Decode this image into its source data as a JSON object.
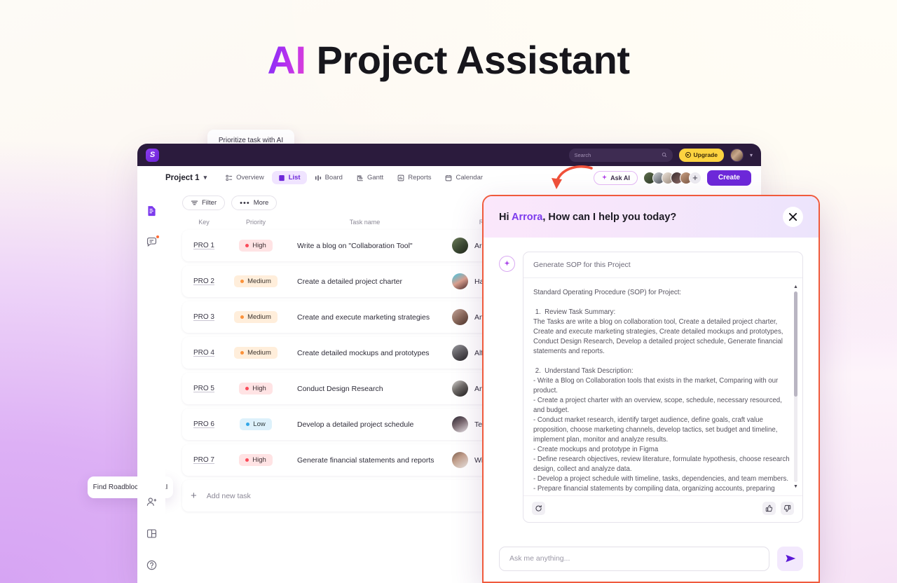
{
  "hero": {
    "ai": "AI",
    "rest": " Project Assistant"
  },
  "topbar": {
    "logo": "brand-logo",
    "search_placeholder": "Search",
    "upgrade_label": "Upgrade"
  },
  "toolbar": {
    "project_name": "Project 1",
    "tabs": [
      {
        "label": "Overview",
        "icon": "overview-icon",
        "active": false
      },
      {
        "label": "List",
        "icon": "list-icon",
        "active": true
      },
      {
        "label": "Board",
        "icon": "board-icon",
        "active": false
      },
      {
        "label": "Gantt",
        "icon": "gantt-icon",
        "active": false
      },
      {
        "label": "Reports",
        "icon": "reports-icon",
        "active": false
      },
      {
        "label": "Calendar",
        "icon": "calendar-icon",
        "active": false
      }
    ],
    "ask_ai_label": "Ask AI",
    "add_member_label": "+",
    "create_label": "Create"
  },
  "sidebar": {
    "items": [
      {
        "icon": "document-icon",
        "active": true,
        "badge": false
      },
      {
        "icon": "chat-bubble-icon",
        "active": false,
        "badge": true
      },
      {
        "icon": "add-user-icon",
        "active": false,
        "badge": false
      },
      {
        "icon": "layout-panel-icon",
        "active": false,
        "badge": false
      },
      {
        "icon": "help-circle-icon",
        "active": false,
        "badge": false
      }
    ]
  },
  "table": {
    "filter_label": "Filter",
    "more_label": "More",
    "columns": [
      "Key",
      "Priority",
      "Task name",
      "Reporter"
    ],
    "sort_indicator": "↑↓",
    "rows": [
      {
        "key": "PRO 1",
        "priority": "High",
        "priority_class": "high",
        "task": "Write a blog on \"Collaboration Tool\"",
        "reporter": "Arrora gaur",
        "avatar": "linear-gradient(140deg,#6d7d5a,#3c4a33 55%,#1f2718)"
      },
      {
        "key": "PRO 2",
        "priority": "Medium",
        "priority_class": "medium",
        "task": "Create a detailed project charter",
        "reporter": "Haylie Philips",
        "avatar": "linear-gradient(150deg,#3fc9e8,#d9a08f 50%,#4b2c2a)"
      },
      {
        "key": "PRO 3",
        "priority": "Medium",
        "priority_class": "medium",
        "task": "Create and execute marketing strategies",
        "reporter": "Ann Baptista",
        "avatar": "linear-gradient(140deg,#c4a59a,#8b6a5c 50%,#4a3229)"
      },
      {
        "key": "PRO 4",
        "priority": "Medium",
        "priority_class": "medium",
        "task": "Create detailed mockups and prototypes",
        "reporter": "Alfonso Dokidis",
        "avatar": "linear-gradient(150deg,#9b9ba0,#5c5a5e 50%,#262428)"
      },
      {
        "key": "PRO 5",
        "priority": "High",
        "priority_class": "high",
        "task": "Conduct Design Research",
        "reporter": "Anika Curtis",
        "avatar": "linear-gradient(145deg,#d6d3d0,#6f6b68 45%,#1c1a19)"
      },
      {
        "key": "PRO 6",
        "priority": "Low",
        "priority_class": "low",
        "task": "Develop a detailed project schedule",
        "reporter": "Terry Calzoni",
        "avatar": "linear-gradient(150deg,#2b2731,#7a6a70 45%,#e8e3e6)"
      },
      {
        "key": "PRO 7",
        "priority": "High",
        "priority_class": "high",
        "task": "Generate financial statements and reports",
        "reporter": "Wilson Dias",
        "avatar": "linear-gradient(145deg,#7a5b4a,#c2a08c 40%,#e9e4e0)"
      }
    ],
    "add_task_label": "Add new task"
  },
  "tooltips": {
    "prioritize": "Prioritize task with AI",
    "roadblocks": "Find Roadblocks with AI"
  },
  "ai_panel": {
    "greeting_prefix": "Hi ",
    "greeting_name": "Arrora",
    "greeting_suffix": ", How can I help you today?",
    "close_icon": "close-icon",
    "prompt": "Generate SOP for this Project",
    "response": "Standard Operating Procedure (SOP) for Project:\n\n 1.  Review Task Summary:\nThe Tasks are write a blog on collaboration tool, Create a detailed project charter, Create and execute marketing strategies, Create detailed mockups and prototypes, Conduct Design Research, Develop a detailed project schedule, Generate financial statements and reports.\n\n 2.  Understand Task Description:\n- Write a Blog on Collaboration tools that exists in the market, Comparing with our product.\n- Create a project charter with an overview, scope, schedule, necessary resourced, and budget.\n- Conduct market research, identify target audience, define goals, craft value proposition, choose marketing channels, develop tactics, set budget and timeline, implement plan, monitor and analyze results.\n- Create mockups and prototype in Figma\n- Define research objectives, review literature, formulate hypothesis, choose research design, collect and analyze data.\n- Develop a project schedule with timeline, tasks, dependencies, and team members.\n- Prepare financial statements by compiling data, organizing accounts, preparing",
    "scroll_up": "▲",
    "scroll_down": "▼",
    "regenerate_icon": "refresh-icon",
    "thumbs_up_icon": "thumbs-up-icon",
    "thumbs_down_icon": "thumbs-down-icon",
    "input_placeholder": "Ask me anything...",
    "send_icon": "send-icon"
  },
  "colors": {
    "accent_purple": "#6d28d9",
    "panel_border": "#f05a3c",
    "upgrade_yellow": "#fdd340",
    "topbar_dark": "#2b1b3d",
    "high": "#fb4b5a",
    "medium": "#fb9139",
    "low": "#32a7e8"
  }
}
